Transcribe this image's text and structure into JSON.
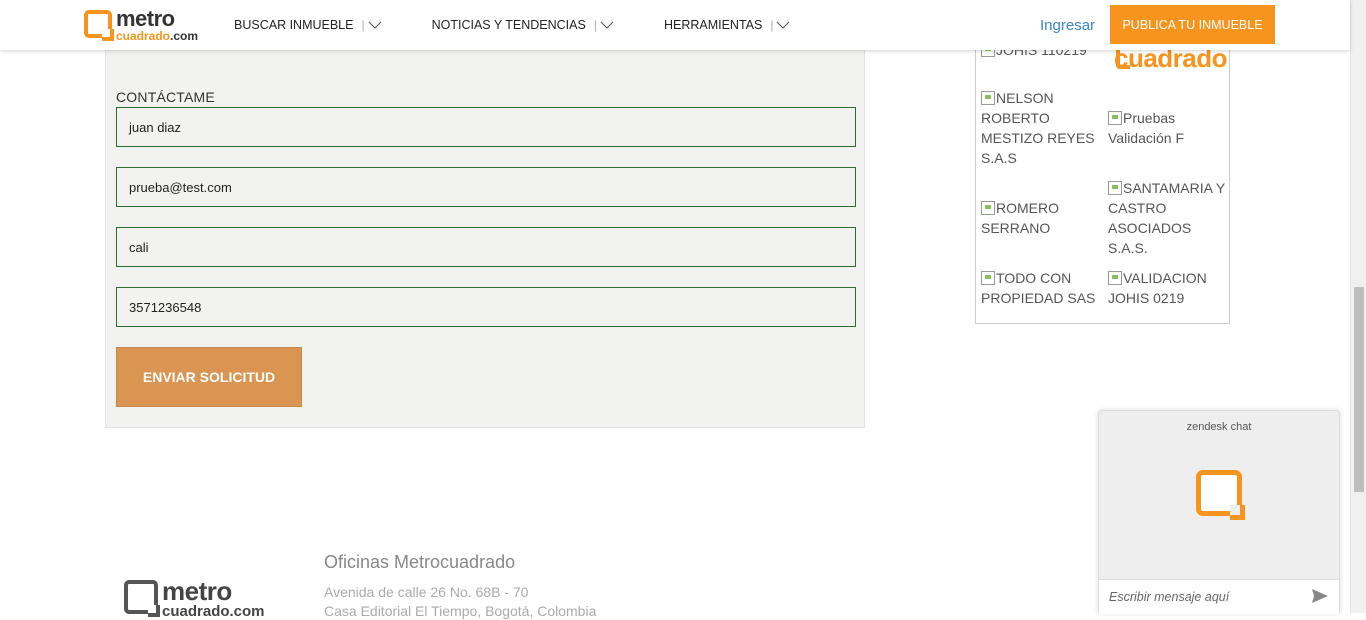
{
  "header": {
    "logo_top": "metro",
    "logo_bottom_a": "cuadrado",
    "logo_bottom_b": ".com",
    "nav": [
      {
        "label": "BUSCAR INMUEBLE",
        "sep": "|"
      },
      {
        "label": "NOTICIAS Y TENDENCIAS",
        "sep": "|"
      },
      {
        "label": "HERRAMIENTAS",
        "sep": "|"
      }
    ],
    "login_label": "Ingresar",
    "publish_label": "PUBLICA TU INMUEBLE"
  },
  "form": {
    "section_label": "CONTÁCTAME",
    "fields": [
      {
        "value": "juan diaz"
      },
      {
        "value": "prueba@test.com"
      },
      {
        "value": "cali"
      },
      {
        "value": "3571236548"
      }
    ],
    "submit_label": "ENVIAR SOLICITUD"
  },
  "sidebar": {
    "agents": [
      {
        "name": "JOHIS 110219"
      },
      {
        "name": "cuadrado"
      },
      {
        "name": "NELSON ROBERTO MESTIZO REYES S.A.S"
      },
      {
        "name": "Pruebas Validación F"
      },
      {
        "name": "ROMERO SERRANO"
      },
      {
        "name": "SANTAMARIA Y CASTRO ASOCIADOS S.A.S."
      },
      {
        "name": "TODO CON PROPIEDAD SAS"
      },
      {
        "name": "VALIDACION JOHIS 0219"
      }
    ]
  },
  "footer": {
    "logo_top": "metro",
    "logo_bottom": "cuadrado.com",
    "office_title": "Oficinas Metrocuadrado",
    "office_lines": [
      "Avenida de calle 26 No. 68B - 70",
      "Casa Editorial El Tiempo, Bogotá, Colombia"
    ]
  },
  "chat": {
    "title": "zendesk chat",
    "placeholder": "Escribir mensaje aquí"
  },
  "colors": {
    "brand_orange": "#f7941d",
    "submit_bg": "#d99551",
    "field_border": "#2e6b2e",
    "link_blue": "#3a87c8"
  }
}
